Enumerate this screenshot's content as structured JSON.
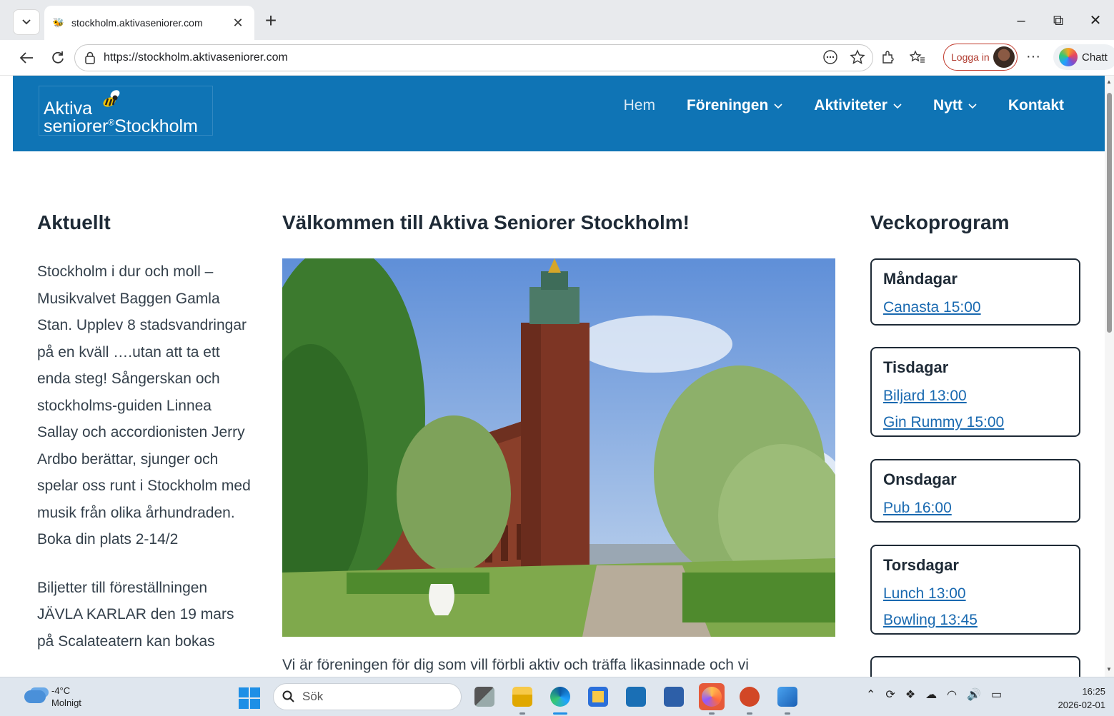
{
  "browser": {
    "tab_title": "stockholm.aktivaseniorer.com",
    "tab_close": "✕",
    "new_tab": "+",
    "url": "https://stockholm.aktivaseniorer.com",
    "login_label": "Logga in",
    "chat_label": "Chatt",
    "more_label": "···",
    "window_controls": {
      "minimize": "–",
      "restore": "⧉",
      "close": "✕"
    }
  },
  "site": {
    "logo": {
      "line1": "Aktiva",
      "line2": "seniorer",
      "mark": "®",
      "line2b": "Stockholm"
    },
    "nav": [
      {
        "label": "Hem",
        "dropdown": false,
        "active": true
      },
      {
        "label": "Föreningen",
        "dropdown": true
      },
      {
        "label": "Aktiviteter",
        "dropdown": true
      },
      {
        "label": "Nytt",
        "dropdown": true
      },
      {
        "label": "Kontakt",
        "dropdown": false
      }
    ],
    "chevron": "⌄"
  },
  "aktuellt": {
    "title": "Aktuellt",
    "items": [
      "Stockholm i dur och moll – Musikvalvet Baggen Gamla Stan. Upplev 8 stadsvandringar på en kväll ….utan att ta ett enda steg! Sångerskan och stockholms-guiden Linnea Sallay och accordionisten Jerry Ardbo berättar, sjunger och spelar oss runt i Stockholm med musik från olika århundraden. Boka din plats 2-14/2",
      "Biljetter till föreställningen JÄVLA KARLAR den 19 mars på Scalateatern kan bokas"
    ]
  },
  "main": {
    "title": "Välkommen till Aktiva Seniorer Stockholm!",
    "intro": "Vi är föreningen för dig som vill förbli aktiv och träffa likasinnade och vi"
  },
  "veckoprogram": {
    "title": "Veckoprogram",
    "days": [
      {
        "day": "Måndagar",
        "activities": [
          "Canasta 15:00"
        ]
      },
      {
        "day": "Tisdagar",
        "activities": [
          "Biljard 13:00",
          "Gin Rummy 15:00"
        ]
      },
      {
        "day": "Onsdagar",
        "activities": [
          "Pub 16:00"
        ]
      },
      {
        "day": "Torsdagar",
        "activities": [
          "Lunch 13:00",
          "Bowling 13:45"
        ]
      },
      {
        "day": "",
        "activities": []
      }
    ]
  },
  "taskbar": {
    "weather_temp": "-4°C",
    "weather_desc": "Molnigt",
    "search_placeholder": "Sök",
    "time": "16:25",
    "date": "2026-02-01",
    "apps": [
      "task-view",
      "file-explorer",
      "edge",
      "store",
      "app-shield",
      "photos",
      "firefox",
      "powerpoint",
      "image-viewer"
    ]
  },
  "colors": {
    "header_blue": "#0f74b5",
    "link_blue": "#1969b0",
    "text_dark": "#1e2a36"
  }
}
